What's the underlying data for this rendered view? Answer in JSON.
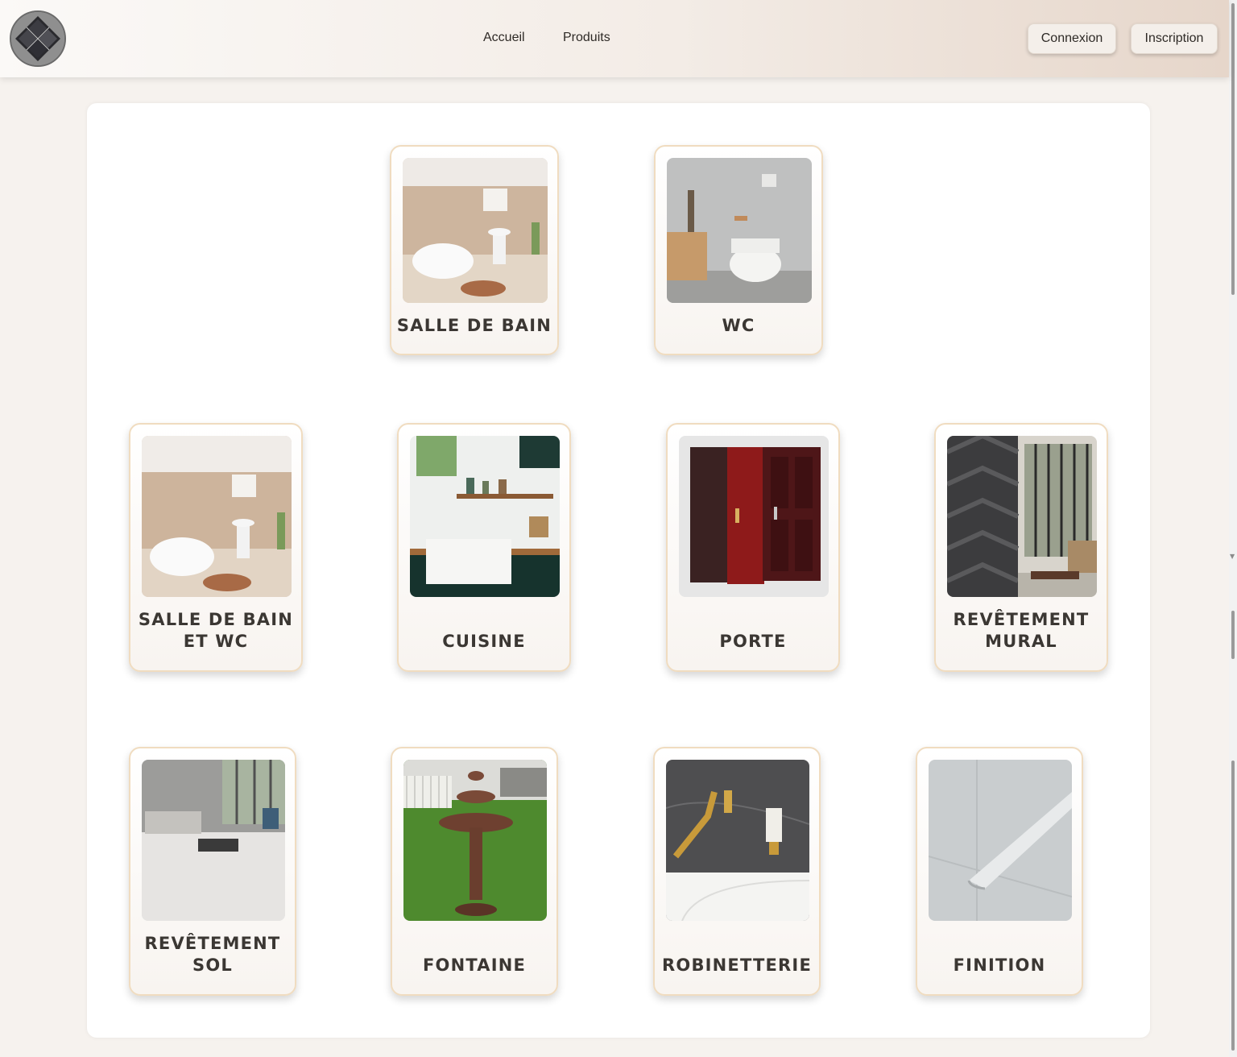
{
  "header": {
    "logo_icon": "diamond-tile-logo",
    "nav": [
      {
        "label": "Accueil"
      },
      {
        "label": "Produits"
      }
    ],
    "buttons": {
      "login": "Connexion",
      "signup": "Inscription"
    }
  },
  "categories": [
    {
      "label": "SALLE DE BAIN",
      "image": "bathroom-photo"
    },
    {
      "label": "WC",
      "image": "toilet-photo"
    },
    {
      "label": "SALLE DE BAIN ET WC",
      "image": "bathroom-wc-photo"
    },
    {
      "label": "CUISINE",
      "image": "kitchen-photo"
    },
    {
      "label": "PORTE",
      "image": "doors-photo"
    },
    {
      "label": "REVÊTEMENT MURAL",
      "image": "wall-covering-photo"
    },
    {
      "label": "REVÊTEMENT SOL",
      "image": "floor-covering-photo"
    },
    {
      "label": "FONTAINE",
      "image": "fountain-photo"
    },
    {
      "label": "ROBINETTERIE",
      "image": "faucets-photo"
    },
    {
      "label": "FINITION",
      "image": "finishing-trim-photo"
    }
  ],
  "colors": {
    "accent_border": "#f0dcc0",
    "text_dark": "#3b3733",
    "header_gradient_end": "#e6d6ca"
  }
}
